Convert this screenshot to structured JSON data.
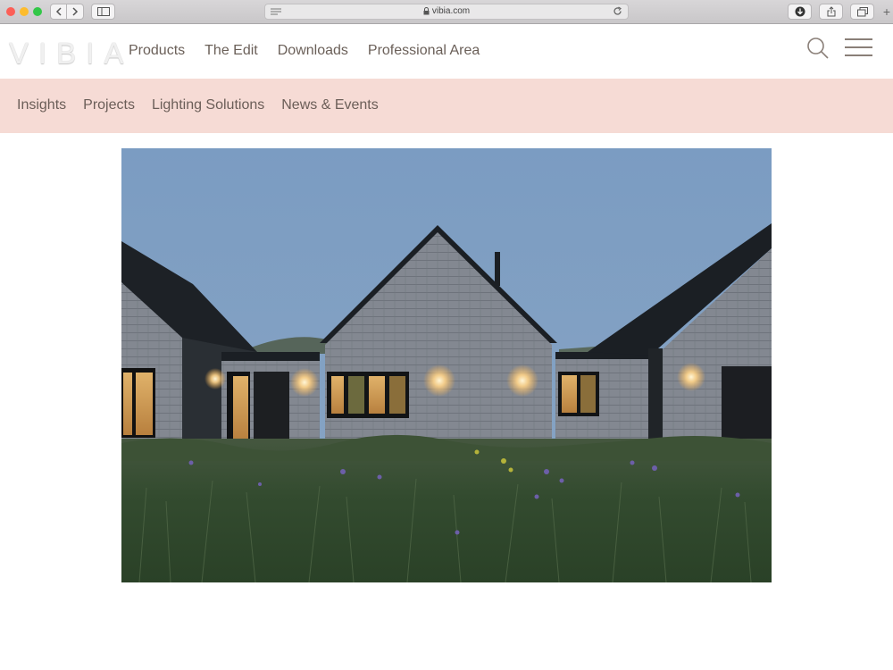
{
  "browser": {
    "url": "vibia.com"
  },
  "site": {
    "logo_text": "VIBIA",
    "main_nav": [
      "Products",
      "The Edit",
      "Downloads",
      "Professional Area"
    ],
    "sub_nav": [
      "Insights",
      "Projects",
      "Lighting Solutions",
      "News & Events"
    ]
  },
  "icons": {
    "search": "search-icon",
    "menu": "hamburger-menu-icon",
    "hero": "house-dusk-photo"
  },
  "colors": {
    "sub_nav_bg": "#f6dbd5",
    "nav_text": "#6b6059",
    "sky": "#7e9dbf",
    "grass": "#2f4a2c"
  }
}
